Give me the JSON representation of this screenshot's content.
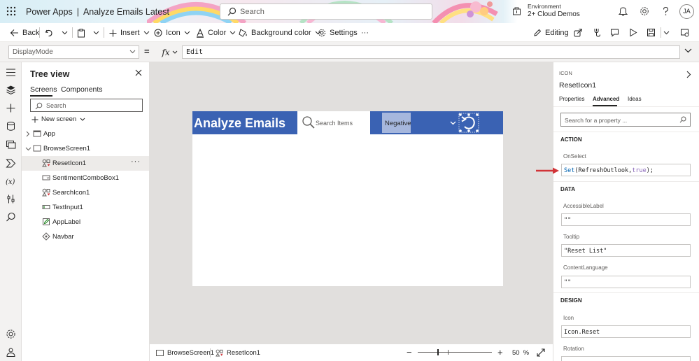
{
  "header": {
    "app_name": "Power Apps",
    "separator": "|",
    "file_name": "Analyze Emails Latest",
    "search_placeholder": "Search",
    "environment_label": "Environment",
    "environment_name": "2+ Cloud Demos",
    "user_initials": "JA"
  },
  "toolbar": {
    "back": "Back",
    "insert": "Insert",
    "icon": "Icon",
    "color": "Color",
    "background_color": "Background color",
    "settings": "Settings",
    "more": "···",
    "editing": "Editing"
  },
  "formula_bar": {
    "property": "DisplayMode",
    "equals": "=",
    "fx": "fx",
    "formula": "Edit"
  },
  "tree_view": {
    "title": "Tree view",
    "tabs": [
      "Screens",
      "Components"
    ],
    "search_placeholder": "Search",
    "new_screen": "New screen",
    "items": [
      {
        "label": "App",
        "selected": false
      },
      {
        "label": "BrowseScreen1",
        "selected": false
      },
      {
        "label": "ResetIcon1",
        "selected": true
      },
      {
        "label": "SentimentComboBox1",
        "selected": false
      },
      {
        "label": "SearchIcon1",
        "selected": false
      },
      {
        "label": "TextInput1",
        "selected": false
      },
      {
        "label": "AppLabel",
        "selected": false
      },
      {
        "label": "Navbar",
        "selected": false
      }
    ],
    "more": "···"
  },
  "canvas": {
    "app_label": "Analyze Emails",
    "search_placeholder": "Search Items",
    "combo_value": "Negative",
    "header_color": "#3a62b3"
  },
  "status_bar": {
    "screen": "BrowseScreen1",
    "control": "ResetIcon1",
    "minus": "−",
    "plus": "+",
    "zoom_value": "50",
    "zoom_unit": "%",
    "zoom_fraction": 0.5
  },
  "properties": {
    "type": "ICON",
    "name": "ResetIcon1",
    "tabs": [
      "Properties",
      "Advanced",
      "Ideas"
    ],
    "active_tab": "Advanced",
    "search_placeholder": "Search for a property ...",
    "sections": {
      "action": "ACTION",
      "data": "DATA",
      "design": "DESIGN"
    },
    "onselect_label": "OnSelect",
    "onselect_fn": "Set",
    "onselect_args_open": "(RefreshOutlook,",
    "onselect_true": "true",
    "onselect_args_close": ");",
    "accessible_label": "AccessibleLabel",
    "accessible_value": "\"\"",
    "tooltip_label": "Tooltip",
    "tooltip_value": "\"Reset List\"",
    "content_language_label": "ContentLanguage",
    "content_language_value": "\"\"",
    "icon_label": "Icon",
    "icon_value": "Icon.Reset",
    "rotation_label": "Rotation"
  },
  "colors": {
    "accent": "#3a62b3",
    "combo_fill": "#a6b7dd",
    "arrow": "#d13438"
  }
}
